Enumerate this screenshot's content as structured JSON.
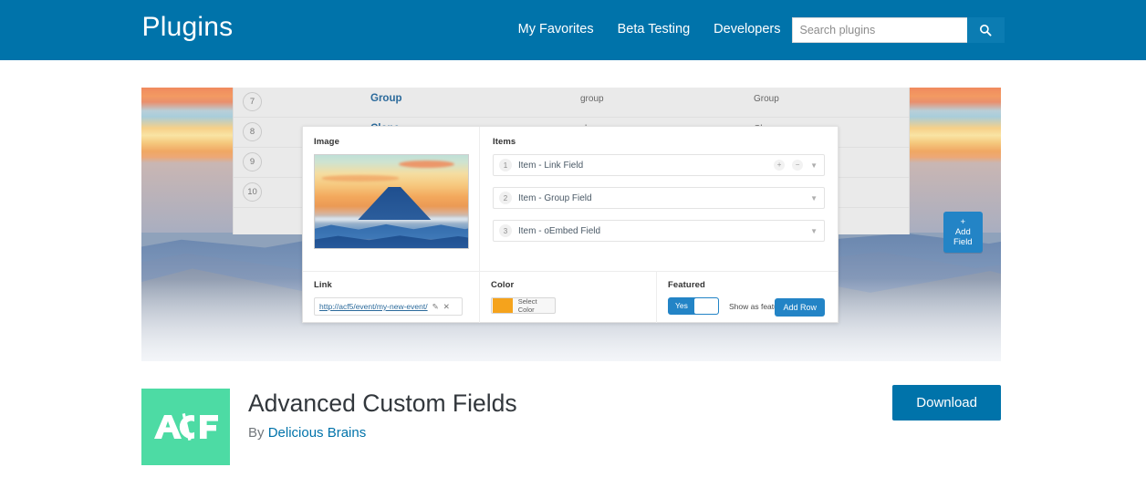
{
  "header": {
    "title": "Plugins",
    "nav": [
      {
        "label": "My Favorites"
      },
      {
        "label": "Beta Testing"
      },
      {
        "label": "Developers"
      }
    ],
    "search": {
      "placeholder": "Search plugins",
      "value": "",
      "icon": "search-icon"
    },
    "bg_color": "#0073aa"
  },
  "banner": {
    "admin_table": {
      "rows": [
        {
          "num": "7",
          "title": "Group",
          "name": "group",
          "type": "Group"
        },
        {
          "num": "8",
          "title": "Clone",
          "name": "clone",
          "type": "Clone"
        },
        {
          "num": "9",
          "title": "",
          "name": "",
          "type": ""
        },
        {
          "num": "10",
          "title": "",
          "name": "",
          "type": ""
        }
      ],
      "add_field_label": "+ Add Field"
    },
    "card": {
      "image_field": {
        "label": "Image",
        "alt": "Mount Fuji at sunset"
      },
      "items_field": {
        "label": "Items",
        "rows": [
          {
            "num": "1",
            "label": "Item - Link Field",
            "controls": [
              "plus-icon",
              "minus-icon",
              "caret-down-icon"
            ]
          },
          {
            "num": "2",
            "label": "Item - Group Field",
            "controls": [
              "caret-down-icon"
            ]
          },
          {
            "num": "3",
            "label": "Item - oEmbed Field",
            "controls": [
              "caret-down-icon"
            ]
          }
        ],
        "add_row_label": "Add Row"
      },
      "link_field": {
        "label": "Link",
        "url": "http://acf5/event/my-new-event/",
        "edit_icon": "pencil-icon",
        "remove_icon": "close-icon"
      },
      "color_field": {
        "label": "Color",
        "swatch": "#f5a31c",
        "button_label": "Select Color"
      },
      "featured_field": {
        "label": "Featured",
        "toggle_label": "Yes",
        "toggle_on": true,
        "note": "Show as featured?"
      }
    }
  },
  "plugin": {
    "logo_text": "ACF",
    "logo_color": "#4ddba4",
    "name": "Advanced Custom Fields",
    "by_prefix": "By ",
    "author": "Delicious Brains",
    "download_label": "Download"
  }
}
